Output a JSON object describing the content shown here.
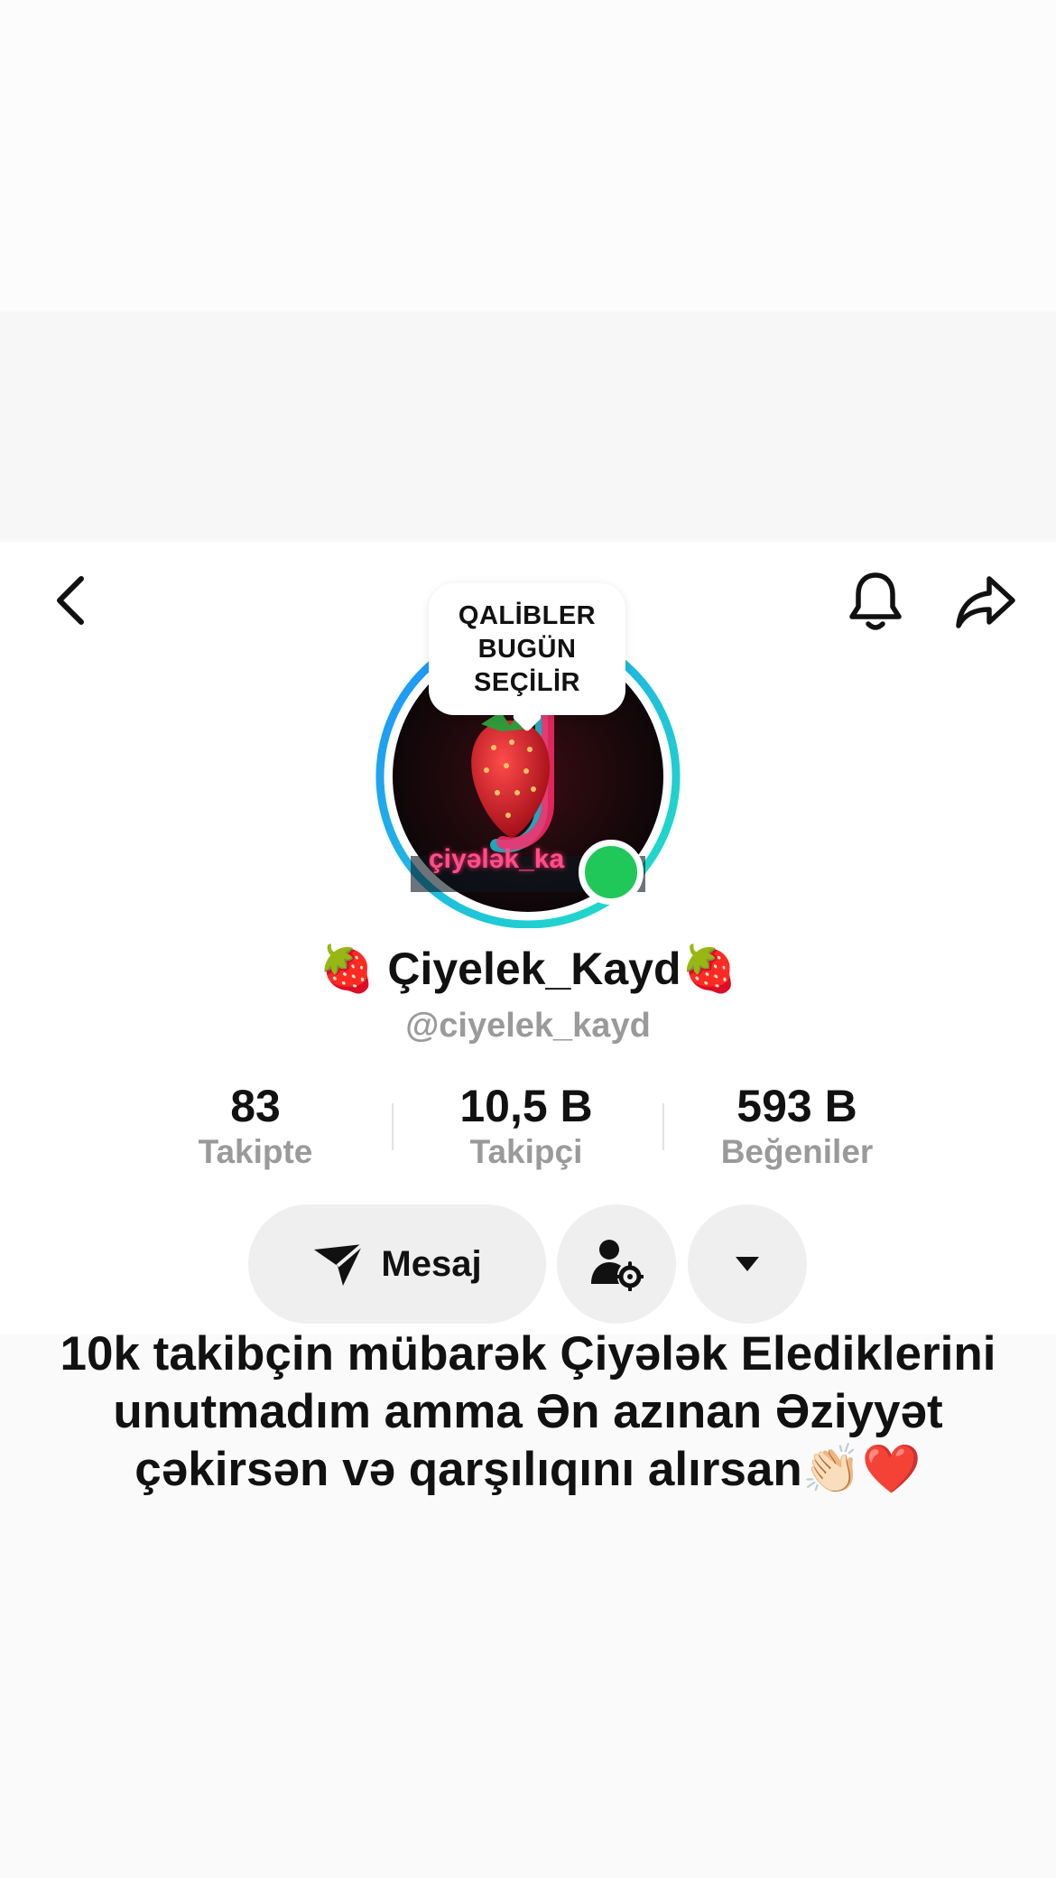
{
  "profile": {
    "bubble_lines": [
      "QALİBLER",
      "BUGÜN",
      "SEÇİLİR"
    ],
    "display_name": "🍓 Çiyelek_Kayd🍓",
    "handle": "@ciyelek_kayd",
    "avatar_text": "çiyələk_ka"
  },
  "stats": [
    {
      "value": "83",
      "label": "Takipte"
    },
    {
      "value": "10,5 B",
      "label": "Takipçi"
    },
    {
      "value": "593 B",
      "label": "Beğeniler"
    }
  ],
  "actions": {
    "message_label": "Mesaj"
  },
  "bio": "10k takibçin mübarək Çiyələk Elediklerini unutmadım amma Ən azınan Əziyyət çəkirsən və qarşılıqını alırsan👏🏻❤️",
  "icons": {
    "back": "chevron-left-icon",
    "notifications": "bell-icon",
    "share": "share-arrow-icon",
    "message": "send-icon",
    "friend_settings": "user-gear-icon",
    "more": "caret-down-icon"
  },
  "colors": {
    "live_indicator": "#20c85a",
    "ring_start": "#1e90ff",
    "ring_end": "#20e3c2"
  }
}
